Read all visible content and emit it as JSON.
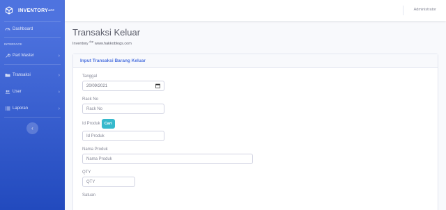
{
  "brand": {
    "name": "INVENTORY",
    "sup": "APP"
  },
  "sidebar": {
    "dashboard": "Dashboard",
    "heading": "INTERFACE",
    "items": [
      {
        "label": "Part Master",
        "icon": "wrench-icon"
      },
      {
        "label": "Transaksi",
        "icon": "folder-icon"
      },
      {
        "label": "User",
        "icon": "users-icon"
      },
      {
        "label": "Laporan",
        "icon": "list-icon"
      }
    ],
    "toggle_icon": "chevron-left-icon"
  },
  "topbar": {
    "user": "Administrator"
  },
  "page": {
    "title": "Transaksi Keluar",
    "subtitle_prefix": "Inventory",
    "subtitle_sup": "App",
    "subtitle_suffix": "www.hakkoblogs.com"
  },
  "card": {
    "title": "Input Transaksi Barang Keluar"
  },
  "form": {
    "tanggal_label": "Tanggal",
    "tanggal_value": "20/09/2021",
    "rack_label": "Rack No",
    "rack_placeholder": "Rack No",
    "id_label": "Id Produk",
    "cari_label": "Cari",
    "id_placeholder": "Id Produk",
    "nama_label": "Nama Produk",
    "nama_placeholder": "Nama Produk",
    "qty_label": "QTY",
    "qty_placeholder": "QTY",
    "satuan_label": "Satuan"
  },
  "colors": {
    "primary": "#4e73df",
    "info": "#36b9cc"
  }
}
